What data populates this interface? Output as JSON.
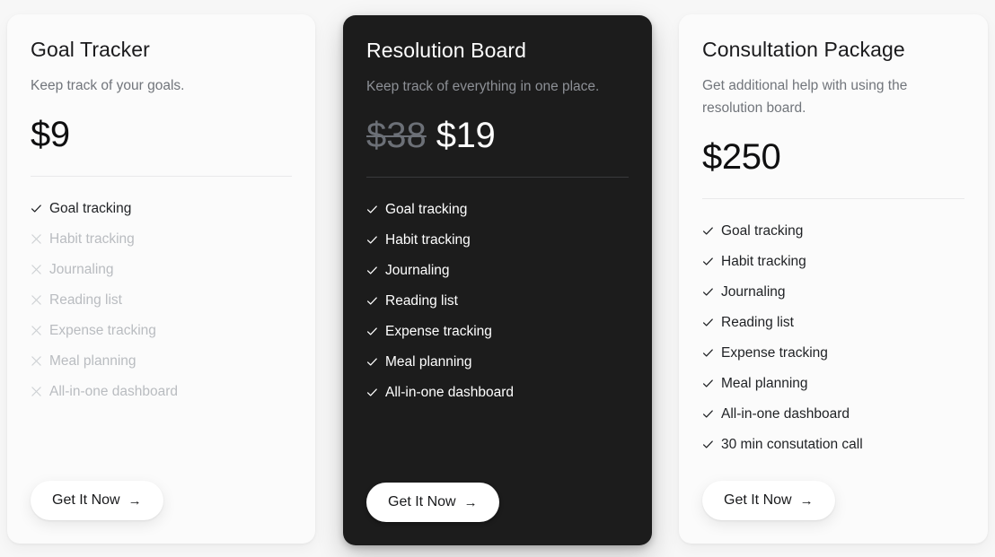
{
  "page": {
    "background_color": "#f7f7f7"
  },
  "cards": [
    {
      "id": "goal-tracker",
      "theme": "light",
      "title": "Goal Tracker",
      "description": "Keep track of your goals.",
      "price": "$9",
      "old_price": null,
      "features": [
        {
          "label": "Goal tracking",
          "included": true,
          "icon": "check-icon"
        },
        {
          "label": "Habit tracking",
          "included": false,
          "icon": "cross-icon"
        },
        {
          "label": "Journaling",
          "included": false,
          "icon": "cross-icon"
        },
        {
          "label": "Reading list",
          "included": false,
          "icon": "cross-icon"
        },
        {
          "label": "Expense tracking",
          "included": false,
          "icon": "cross-icon"
        },
        {
          "label": "Meal planning",
          "included": false,
          "icon": "cross-icon"
        },
        {
          "label": "All-in-one dashboard",
          "included": false,
          "icon": "cross-icon"
        }
      ],
      "cta_label": "Get It Now",
      "cta_arrow": "→"
    },
    {
      "id": "resolution-board",
      "theme": "dark",
      "title": "Resolution Board",
      "description": "Keep track of everything in one place.",
      "price": "$19",
      "old_price": "$38",
      "features": [
        {
          "label": "Goal tracking",
          "included": true,
          "icon": "check-icon"
        },
        {
          "label": "Habit tracking",
          "included": true,
          "icon": "check-icon"
        },
        {
          "label": "Journaling",
          "included": true,
          "icon": "check-icon"
        },
        {
          "label": "Reading list",
          "included": true,
          "icon": "check-icon"
        },
        {
          "label": "Expense tracking",
          "included": true,
          "icon": "check-icon"
        },
        {
          "label": "Meal planning",
          "included": true,
          "icon": "check-icon"
        },
        {
          "label": "All-in-one dashboard",
          "included": true,
          "icon": "check-icon"
        }
      ],
      "cta_label": "Get It Now",
      "cta_arrow": "→"
    },
    {
      "id": "consultation-package",
      "theme": "light",
      "title": "Consultation Package",
      "description": "Get additional help with using the resolution board.",
      "price": "$250",
      "old_price": null,
      "features": [
        {
          "label": "Goal tracking",
          "included": true,
          "icon": "check-icon"
        },
        {
          "label": "Habit tracking",
          "included": true,
          "icon": "check-icon"
        },
        {
          "label": "Journaling",
          "included": true,
          "icon": "check-icon"
        },
        {
          "label": "Reading list",
          "included": true,
          "icon": "check-icon"
        },
        {
          "label": "Expense tracking",
          "included": true,
          "icon": "check-icon"
        },
        {
          "label": "Meal planning",
          "included": true,
          "icon": "check-icon"
        },
        {
          "label": "All-in-one dashboard",
          "included": true,
          "icon": "check-icon"
        },
        {
          "label": "30 min consutation call",
          "included": true,
          "icon": "check-icon"
        }
      ],
      "cta_label": "Get It Now",
      "cta_arrow": "→"
    }
  ]
}
